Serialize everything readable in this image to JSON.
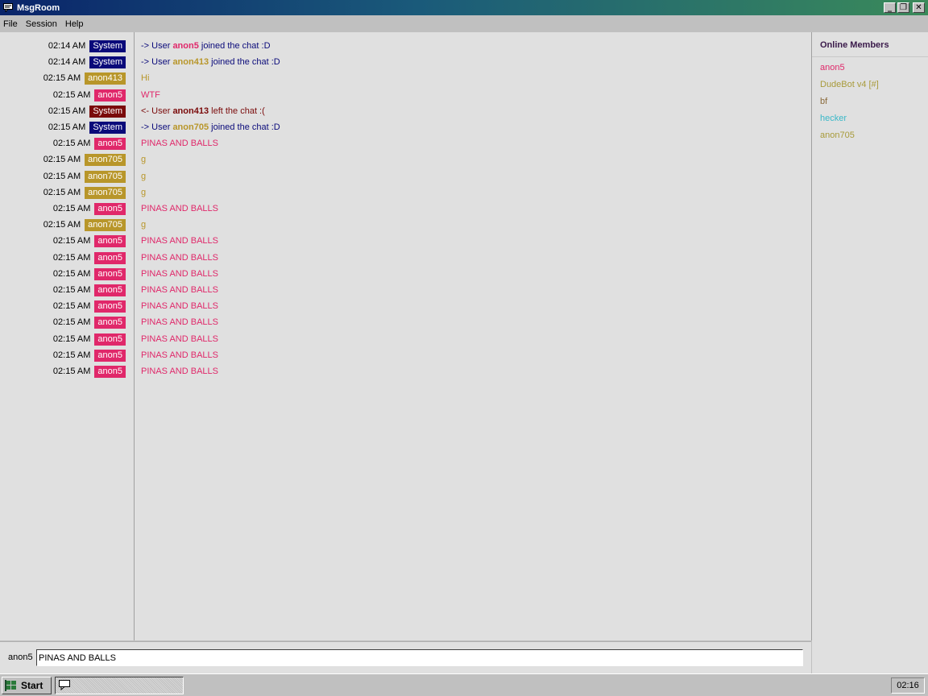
{
  "window": {
    "title": "MsgRoom"
  },
  "menu": [
    "File",
    "Session",
    "Help"
  ],
  "colors": {
    "system": "#0a0a7a",
    "system_leave": "#7a0a0a",
    "anon5": "#e0286a",
    "anon413": "#b8962a",
    "anon705": "#b8962a"
  },
  "messages": [
    {
      "time": "02:14 AM",
      "user": "System",
      "color": "#0a0a7a",
      "text_pre": "-> User ",
      "text_bold": "anon5",
      "bold_color": "#e0286a",
      "text_post": " joined the chat :D",
      "text_color": "#0a0a7a"
    },
    {
      "time": "02:14 AM",
      "user": "System",
      "color": "#0a0a7a",
      "text_pre": "-> User ",
      "text_bold": "anon413",
      "bold_color": "#b8962a",
      "text_post": " joined the chat :D",
      "text_color": "#0a0a7a"
    },
    {
      "time": "02:15 AM",
      "user": "anon413",
      "color": "#b8962a",
      "text_pre": "Hi",
      "text_bold": "",
      "bold_color": "",
      "text_post": "",
      "text_color": "#b8962a"
    },
    {
      "time": "02:15 AM",
      "user": "anon5",
      "color": "#e0286a",
      "text_pre": "WTF",
      "text_bold": "",
      "bold_color": "",
      "text_post": "",
      "text_color": "#e0286a"
    },
    {
      "time": "02:15 AM",
      "user": "System",
      "color": "#7a0a0a",
      "text_pre": "<- User ",
      "text_bold": "anon413",
      "bold_color": "#7a0a0a",
      "text_post": " left the chat :(",
      "text_color": "#7a0a0a"
    },
    {
      "time": "02:15 AM",
      "user": "System",
      "color": "#0a0a7a",
      "text_pre": "-> User ",
      "text_bold": "anon705",
      "bold_color": "#b8962a",
      "text_post": " joined the chat :D",
      "text_color": "#0a0a7a"
    },
    {
      "time": "02:15 AM",
      "user": "anon5",
      "color": "#e0286a",
      "text_pre": "PINAS AND BALLS",
      "text_bold": "",
      "bold_color": "",
      "text_post": "",
      "text_color": "#e0286a"
    },
    {
      "time": "02:15 AM",
      "user": "anon705",
      "color": "#b8962a",
      "text_pre": "g",
      "text_bold": "",
      "bold_color": "",
      "text_post": "",
      "text_color": "#b8962a"
    },
    {
      "time": "02:15 AM",
      "user": "anon705",
      "color": "#b8962a",
      "text_pre": "g",
      "text_bold": "",
      "bold_color": "",
      "text_post": "",
      "text_color": "#b8962a"
    },
    {
      "time": "02:15 AM",
      "user": "anon705",
      "color": "#b8962a",
      "text_pre": "g",
      "text_bold": "",
      "bold_color": "",
      "text_post": "",
      "text_color": "#b8962a"
    },
    {
      "time": "02:15 AM",
      "user": "anon5",
      "color": "#e0286a",
      "text_pre": "PINAS AND BALLS",
      "text_bold": "",
      "bold_color": "",
      "text_post": "",
      "text_color": "#e0286a"
    },
    {
      "time": "02:15 AM",
      "user": "anon705",
      "color": "#b8962a",
      "text_pre": "g",
      "text_bold": "",
      "bold_color": "",
      "text_post": "",
      "text_color": "#b8962a"
    },
    {
      "time": "02:15 AM",
      "user": "anon5",
      "color": "#e0286a",
      "text_pre": "PINAS AND BALLS",
      "text_bold": "",
      "bold_color": "",
      "text_post": "",
      "text_color": "#e0286a"
    },
    {
      "time": "02:15 AM",
      "user": "anon5",
      "color": "#e0286a",
      "text_pre": "PINAS AND BALLS",
      "text_bold": "",
      "bold_color": "",
      "text_post": "",
      "text_color": "#e0286a"
    },
    {
      "time": "02:15 AM",
      "user": "anon5",
      "color": "#e0286a",
      "text_pre": "PINAS AND BALLS",
      "text_bold": "",
      "bold_color": "",
      "text_post": "",
      "text_color": "#e0286a"
    },
    {
      "time": "02:15 AM",
      "user": "anon5",
      "color": "#e0286a",
      "text_pre": "PINAS AND BALLS",
      "text_bold": "",
      "bold_color": "",
      "text_post": "",
      "text_color": "#e0286a"
    },
    {
      "time": "02:15 AM",
      "user": "anon5",
      "color": "#e0286a",
      "text_pre": "PINAS AND BALLS",
      "text_bold": "",
      "bold_color": "",
      "text_post": "",
      "text_color": "#e0286a"
    },
    {
      "time": "02:15 AM",
      "user": "anon5",
      "color": "#e0286a",
      "text_pre": "PINAS AND BALLS",
      "text_bold": "",
      "bold_color": "",
      "text_post": "",
      "text_color": "#e0286a"
    },
    {
      "time": "02:15 AM",
      "user": "anon5",
      "color": "#e0286a",
      "text_pre": "PINAS AND BALLS",
      "text_bold": "",
      "bold_color": "",
      "text_post": "",
      "text_color": "#e0286a"
    },
    {
      "time": "02:15 AM",
      "user": "anon5",
      "color": "#e0286a",
      "text_pre": "PINAS AND BALLS",
      "text_bold": "",
      "bold_color": "",
      "text_post": "",
      "text_color": "#e0286a"
    },
    {
      "time": "02:15 AM",
      "user": "anon5",
      "color": "#e0286a",
      "text_pre": "PINAS AND BALLS",
      "text_bold": "",
      "bold_color": "",
      "text_post": "",
      "text_color": "#e0286a"
    }
  ],
  "members": {
    "title": "Online Members",
    "list": [
      {
        "name": "anon5",
        "color": "#e0286a"
      },
      {
        "name": "DudeBot v4 [#]",
        "color": "#a89a3a"
      },
      {
        "name": "bf",
        "color": "#8a6a3a"
      },
      {
        "name": "hecker",
        "color": "#3ab8c8"
      },
      {
        "name": "anon705",
        "color": "#a89a3a"
      }
    ]
  },
  "input": {
    "username": "anon5",
    "value": "PINAS AND BALLS"
  },
  "taskbar": {
    "start_label": "Start",
    "clock": "02:16"
  }
}
